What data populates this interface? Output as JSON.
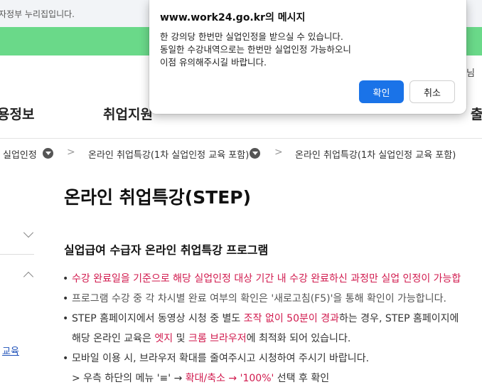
{
  "topbar": {
    "notice": "자정부 누리집입니다."
  },
  "header": {
    "right_text": "님"
  },
  "gnb": {
    "items": [
      "용정보",
      "취업지원",
      "출"
    ]
  },
  "breadcrumb": {
    "items": [
      "실업인정",
      "온라인 취업특강(1차 실업인정 교육 포함)",
      "온라인 취업특강(1차 실업인정 교육 포함)"
    ],
    "separator": ">"
  },
  "main": {
    "title": "온라인 취업특강(STEP)",
    "section_title": "실업급여 수급자 온라인 취업특강 프로그램",
    "bullets": {
      "b1": "수강 완료일을 기준으로 해당 실업인정 대상 기간 내 수강 완료하신 과정만 실업 인정이 가능합",
      "b2": "프로그램 수강 중 각 차시별 완료 여부의 확인은 '새로고침(F5)'을 통해 확인이 가능합니다.",
      "b3_1a": "STEP 홈페이지에서 동영상 시청 중 별도 ",
      "b3_1b": "조작 없이 50분이 경과",
      "b3_1c": "하는 경우, STEP 홈페이지에",
      "b3_2a": "해당 온라인 교육은 ",
      "b3_2b": "엣지",
      "b3_2c": " 및 ",
      "b3_2d": "크롬 브라우저",
      "b3_2e": "에 최적화 되어 있습니다.",
      "b4_1": "모바일 이용 시, 브라우저 확대를 줄여주시고 시청하여 주시기 바랍니다.",
      "b4_2a": "> 우측 하단의 메뉴 '≡' → ",
      "b4_2b": "확대/축소 → '100%'",
      "b4_2c": " 선택 후 확인"
    }
  },
  "sidebar": {
    "link": "교육"
  },
  "dialog": {
    "title": "www.work24.go.kr의 메시지",
    "lines": [
      "한 강의당 한번만 실업인정을 받으실 수 있습니다.",
      "동일한 수강내역으로는 한번만 실업인정 가능하오니",
      "이점 유의해주시길 바랍니다."
    ],
    "ok_label": "확인",
    "cancel_label": "취소"
  },
  "colors": {
    "accent_red": "#d11a4e",
    "green_bar": "#6ad989",
    "button_blue": "#1a73e8"
  }
}
